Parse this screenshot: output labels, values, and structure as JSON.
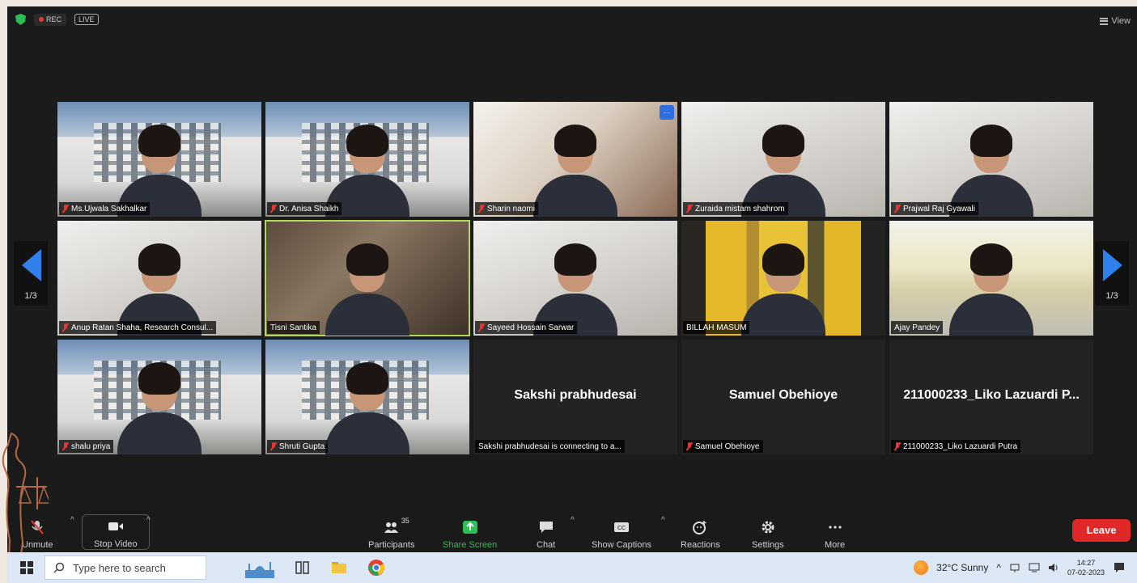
{
  "topbar": {
    "rec_label": "REC",
    "live_label": "LIVE",
    "view_label": "View"
  },
  "pagination": {
    "left_page": "1/3",
    "right_page": "1/3"
  },
  "participants": [
    {
      "name": "Ms.Ujwala Sakhalkar",
      "muted": true,
      "bg": "bld"
    },
    {
      "name": "Dr. Anisa Shaikh",
      "muted": true,
      "bg": "bld"
    },
    {
      "name": "Sharin naomi",
      "muted": true,
      "bg": "warm"
    },
    {
      "name": "Zuraida mistam shahrom",
      "muted": true,
      "bg": "room"
    },
    {
      "name": "Prajwal Raj Gyawali",
      "muted": true,
      "bg": "room"
    },
    {
      "name": "Anup Ratan Shaha, Research Consul...",
      "muted": true,
      "bg": "room"
    },
    {
      "name": "Tisni Santika",
      "muted": false,
      "bg": "office"
    },
    {
      "name": "Sayeed Hossain Sarwar",
      "muted": true,
      "bg": "room"
    },
    {
      "name": "BILLAH MASUM",
      "muted": false,
      "bg": "yellow"
    },
    {
      "name": "Ajay Pandey",
      "muted": false,
      "bg": "board"
    },
    {
      "name": "shalu priya",
      "muted": true,
      "bg": "bld"
    },
    {
      "name": "Shruti Gupta",
      "muted": true,
      "bg": "bld"
    },
    {
      "name": "Sakshi prabhudesai is connecting to a...",
      "big_name": "Sakshi prabhudesai",
      "muted": false,
      "bg": "dark"
    },
    {
      "name": "Samuel Obehioye",
      "big_name": "Samuel Obehioye",
      "muted": true,
      "bg": "dark"
    },
    {
      "name": "211000233_Liko Lazuardi Putra",
      "big_name": "211000233_Liko Lazuardi P...",
      "muted": true,
      "bg": "dark"
    }
  ],
  "toolbar": {
    "unmute": "Unmute",
    "stop_video": "Stop Video",
    "participants": "Participants",
    "participants_count": "35",
    "share_screen": "Share Screen",
    "chat": "Chat",
    "show_captions": "Show Captions",
    "reactions": "Reactions",
    "settings": "Settings",
    "more": "More",
    "leave": "Leave"
  },
  "taskbar": {
    "search_placeholder": "Type here to search",
    "weather": "32°C  Sunny",
    "time": "14:27",
    "date": "07-02-2023"
  },
  "colors": {
    "accent_blue": "#2f80ed",
    "leave_red": "#e02828",
    "share_green": "#2dbf55",
    "active_speaker": "#b6d65a"
  }
}
